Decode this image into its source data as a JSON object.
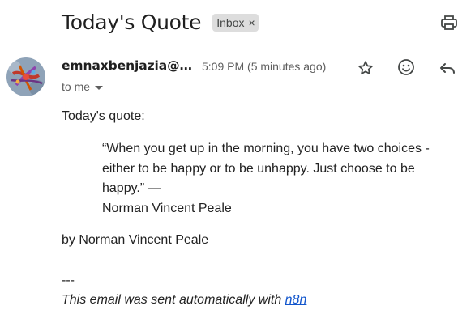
{
  "email": {
    "subject": "Today's Quote",
    "label": "Inbox",
    "label_remove": "×",
    "sender": "emnaxbenjazia@…",
    "time": "5:09 PM (5 minutes ago)",
    "recipient": "to me"
  },
  "body": {
    "intro": "Today's quote:",
    "quote_line1": "“When you get up in the morning, you have two choices -",
    "quote_line2": "either to be happy or to be unhappy. Just choose to be",
    "quote_line3": "happy.” —",
    "quote_author": "Norman Vincent Peale",
    "byline": "by Norman Vincent Peale",
    "separator": "---",
    "footer_prefix": "This email was sent automatically with ",
    "footer_link": "n8n"
  },
  "icons": {
    "print": "print-icon",
    "star": "star-icon",
    "emoji": "emoji-icon",
    "reply": "reply-icon",
    "dropdown": "caret-down-icon"
  },
  "colors": {
    "text": "#222222",
    "secondary": "#5e5e5e",
    "chip_bg": "#dddddd",
    "link": "#1155cc"
  }
}
